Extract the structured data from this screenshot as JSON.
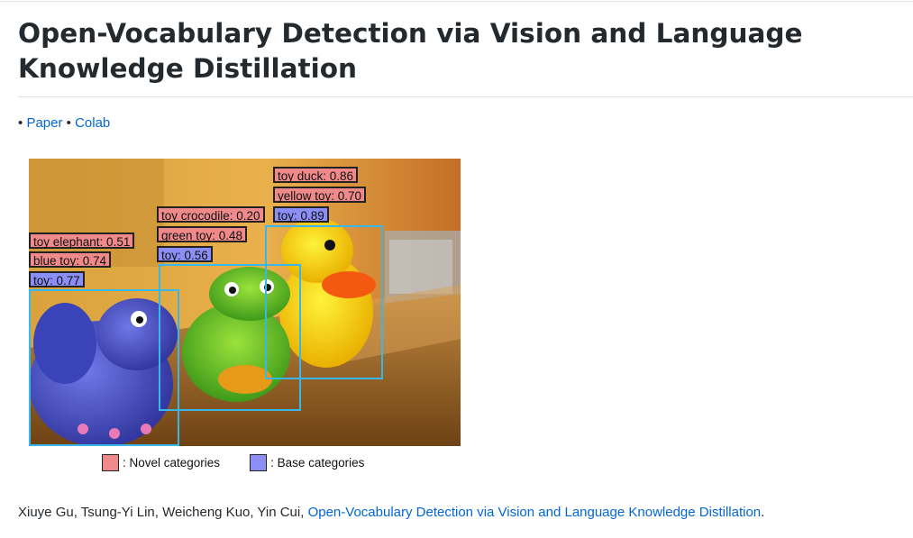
{
  "page": {
    "title": "Open-Vocabulary Detection via Vision and Language Knowledge Distillation",
    "links_prefix": "•",
    "links_separator": "•",
    "link_paper": "Paper",
    "link_colab": "Colab"
  },
  "figure": {
    "labels": {
      "duck_novel_1": "toy duck: 0.86",
      "duck_novel_2": "yellow toy: 0.70",
      "duck_base": "toy: 0.89",
      "croc_novel_1": "toy crocodile: 0.20",
      "croc_novel_2": "green toy: 0.48",
      "croc_base": "toy: 0.56",
      "elephant_novel_1": "toy elephant: 0.51",
      "elephant_novel_2": "blue toy: 0.74",
      "elephant_base": "toy: 0.77"
    },
    "legend": {
      "novel": ": Novel categories",
      "base": ": Base categories"
    },
    "colors": {
      "novel": "#f08a8a",
      "base": "#8a8ef5",
      "box": "#39b7ea"
    }
  },
  "citation": {
    "authors": "Xiuye Gu, Tsung-Yi Lin, Weicheng Kuo, Yin Cui, ",
    "link_text": "Open-Vocabulary Detection via Vision and Language Knowledge Distillation",
    "suffix": "."
  }
}
